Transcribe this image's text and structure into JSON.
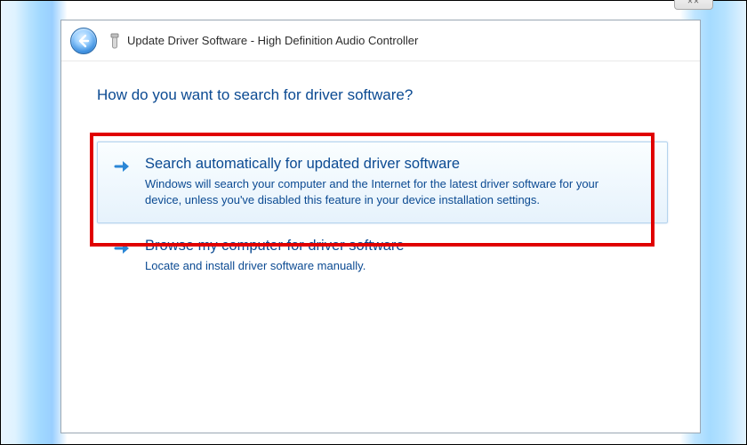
{
  "window": {
    "close_glyph": "✕✕"
  },
  "header": {
    "back_aria": "Back",
    "title": "Update Driver Software - High Definition Audio Controller"
  },
  "body": {
    "question": "How do you want to search for driver software?",
    "options": [
      {
        "title": "Search automatically for updated driver software",
        "desc": "Windows will search your computer and the Internet for the latest driver software for your device, unless you've disabled this feature in your device installation settings."
      },
      {
        "title": "Browse my computer for driver software",
        "desc": "Locate and install driver software manually."
      }
    ]
  },
  "colors": {
    "accent": "#0b4a92",
    "highlight_border": "#e00000"
  }
}
